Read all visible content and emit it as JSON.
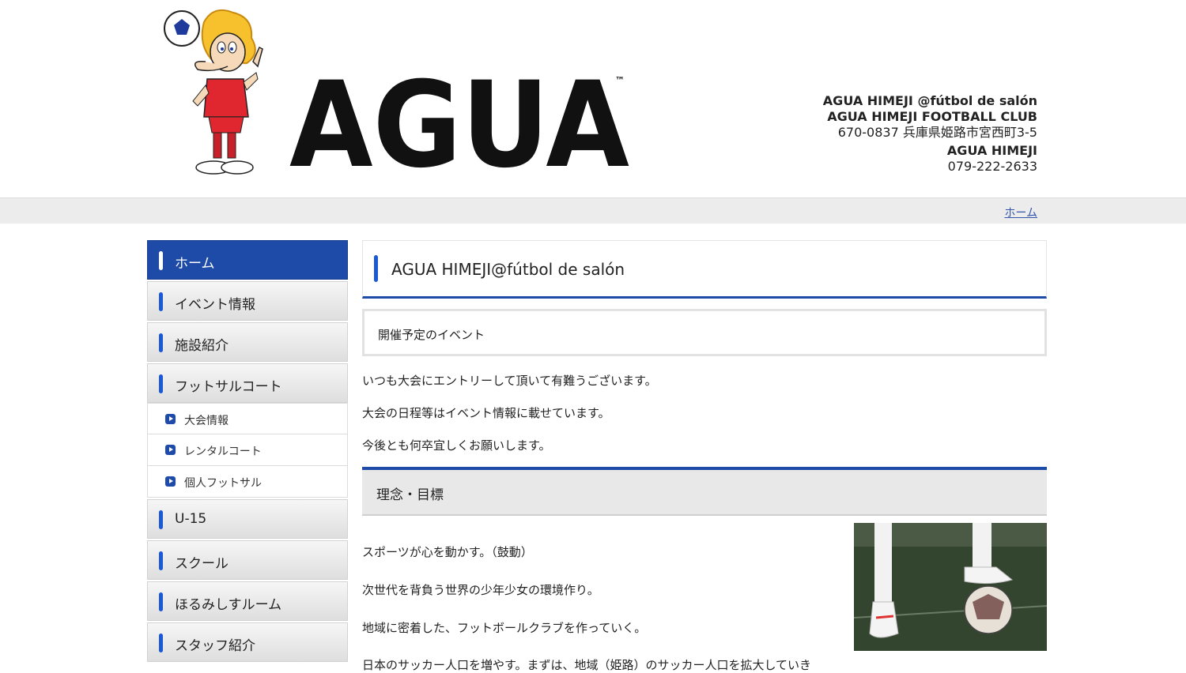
{
  "header": {
    "logo_text": "AGUA",
    "contact": {
      "line1": "AGUA HIMEJI @fútbol de salón",
      "line2": "AGUA HIMEJI FOOTBALL CLUB",
      "address": "670-0837 兵庫県姫路市宮西町3-5",
      "name": "AGUA HIMEJI",
      "phone": "079-222-2633"
    }
  },
  "breadcrumb": {
    "home": "ホーム"
  },
  "sidebar": {
    "items": [
      {
        "label": "ホーム",
        "active": true
      },
      {
        "label": "イベント情報"
      },
      {
        "label": "施設紹介"
      },
      {
        "label": "フットサルコート"
      }
    ],
    "sub_items": [
      {
        "label": "大会情報"
      },
      {
        "label": "レンタルコート"
      },
      {
        "label": "個人フットサル"
      }
    ],
    "items_after": [
      {
        "label": "U-15"
      },
      {
        "label": "スクール"
      },
      {
        "label": "ほるみしすルーム"
      },
      {
        "label": "スタッフ紹介"
      }
    ]
  },
  "main": {
    "title": "AGUA HIMEJI@fútbol de salón",
    "event_heading": "開催予定のイベント",
    "paragraphs": [
      "いつも大会にエントリーして頂いて有難うございます。",
      "大会の日程等はイベント情報に載せています。",
      "今後とも何卒宜しくお願いします。"
    ],
    "section_heading": "理念・目標",
    "philosophy": [
      "スポーツが心を動かす。（鼓動）",
      "次世代を背負う世界の少年少女の環境作り。",
      "地域に密着した、フットボールクラブを作っていく。",
      "日本のサッカー人口を増やす。まずは、地域（姫路）のサッカー人口を拡大していき"
    ]
  },
  "colors": {
    "accent": "#1e4aa8",
    "nav_bar": "#1a5ad6"
  }
}
